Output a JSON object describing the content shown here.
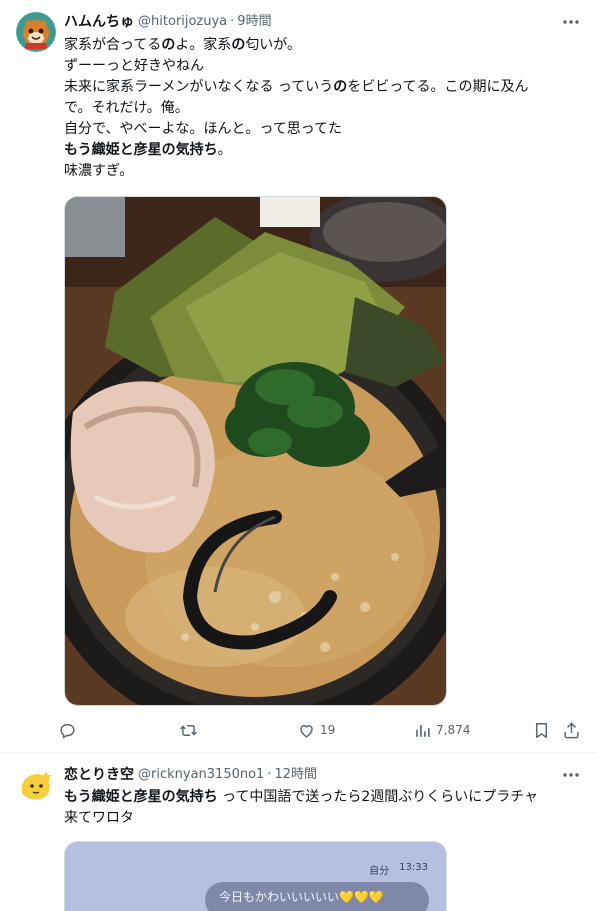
{
  "tweets": [
    {
      "display_name": "ハムんちゅ",
      "handle": "@hitorijozuya",
      "separator": "·",
      "time": "9時間",
      "text_lines": [
        [
          {
            "t": "家系が合ってる"
          },
          {
            "t": "の",
            "b": true
          },
          {
            "t": "よ。家系"
          },
          {
            "t": "の",
            "b": true
          },
          {
            "t": "匂いが。"
          }
        ],
        [
          {
            "t": "ずーーっと好きやねん"
          }
        ],
        [
          {
            "t": "未来に家系ラーメンがいなくなる っていう"
          },
          {
            "t": "の",
            "b": true
          },
          {
            "t": "をビビってる。この期に及ん"
          }
        ],
        [
          {
            "t": "で。それだけ。俺。"
          }
        ],
        [
          {
            "t": "自分で、やべーよな。ほんと。って思ってた"
          }
        ],
        [
          {
            "t": "もう織姫と彦星の気持ち",
            "b": true
          },
          {
            "t": "。"
          }
        ],
        [
          {
            "t": "味濃すぎ。"
          }
        ]
      ],
      "media_alt": "家系ラーメンの写真",
      "actions": {
        "reply": {
          "icon": "reply-icon",
          "count": ""
        },
        "retweet": {
          "icon": "retweet-icon",
          "count": ""
        },
        "like": {
          "icon": "heart-icon",
          "count": "19"
        },
        "views": {
          "icon": "views-icon",
          "count": "7,874"
        },
        "bookmark": {
          "icon": "bookmark-icon"
        },
        "share": {
          "icon": "share-icon"
        }
      }
    },
    {
      "display_name": "恋とりき空",
      "handle": "@ricknyan3150no1",
      "separator": "·",
      "time": "12時間",
      "text_lines": [
        [
          {
            "t": "もう織姫と彦星の気持ち",
            "b": true
          },
          {
            "t": " って中国語で送ったら2週間ぶりくらいにプラチャ"
          }
        ],
        [
          {
            "t": "来てワロタ"
          }
        ]
      ],
      "chat_preview": {
        "sender": "自分",
        "time": "13:33",
        "message": "今日もかわいいいいい💛💛💛"
      }
    }
  ],
  "colors": {
    "text": "#0f1419",
    "secondary": "#536471",
    "border": "#eff3f4"
  }
}
